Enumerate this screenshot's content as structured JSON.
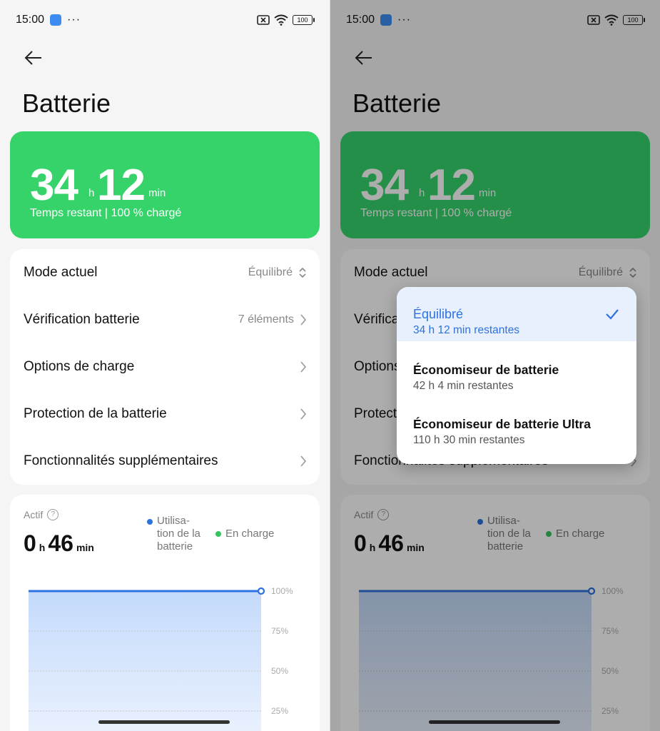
{
  "status": {
    "time": "15:00",
    "dots": "···",
    "battery": "100"
  },
  "page": {
    "title": "Batterie"
  },
  "hero": {
    "hours": "34",
    "h_unit": "h",
    "minutes": "12",
    "min_unit": "min",
    "subtitle": "Temps restant | 100 % chargé"
  },
  "settings": {
    "mode_label": "Mode actuel",
    "mode_value": "Équilibré",
    "check_label": "Vérification batterie",
    "check_value": "7 éléments",
    "charge_label": "Options de charge",
    "protect_label": "Protection de la batterie",
    "extra_label": "Fonctionnalités supplémentaires"
  },
  "usage": {
    "active_label": "Actif",
    "hours": "0",
    "h_unit": "h",
    "minutes": "46",
    "min_unit": "min",
    "legend_usage": "Utilisa-tion de la batterie",
    "legend_charge": "En charge",
    "ticks": [
      "100%",
      "75%",
      "50%",
      "25%"
    ]
  },
  "popup": {
    "options": [
      {
        "title": "Équilibré",
        "sub": "34 h 12 min restantes",
        "selected": true
      },
      {
        "title": "Économiseur de batterie",
        "sub": "42 h 4 min restantes",
        "selected": false
      },
      {
        "title": "Économiseur de batterie Ultra",
        "sub": "110 h 30 min restantes",
        "selected": false
      }
    ]
  },
  "colors": {
    "hero": "#35d36a",
    "hero_dim": "#2a9f4e",
    "accent": "#2d72e0",
    "charge": "#35c55e",
    "usage": "#2d72e0"
  },
  "chart_data": {
    "type": "area",
    "series": [
      {
        "name": "Utilisa-tion de la batterie",
        "values": [
          100,
          100
        ]
      }
    ],
    "yticks": [
      "100%",
      "75%",
      "50%",
      "25%"
    ]
  }
}
